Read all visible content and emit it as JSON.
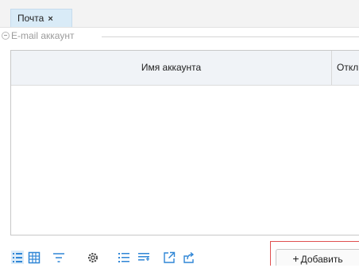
{
  "tabs": [
    {
      "label": "Почта",
      "close": "×"
    }
  ],
  "section": {
    "legend": "E-mail аккаунт"
  },
  "grid": {
    "columns": [
      "Имя аккаунта",
      "Откл"
    ]
  },
  "toolbar": {
    "icons": [
      "list-view-icon",
      "table-view-icon",
      "filter-icon",
      "settings-icon",
      "numbered-list-icon",
      "list-add-icon",
      "external-link-icon",
      "share-icon"
    ],
    "add_plus": "+",
    "add_label": "Добавить"
  },
  "colors": {
    "accent": "#2f86d6",
    "tab_active": "#d9ebf7",
    "highlight_border": "#e05050"
  }
}
